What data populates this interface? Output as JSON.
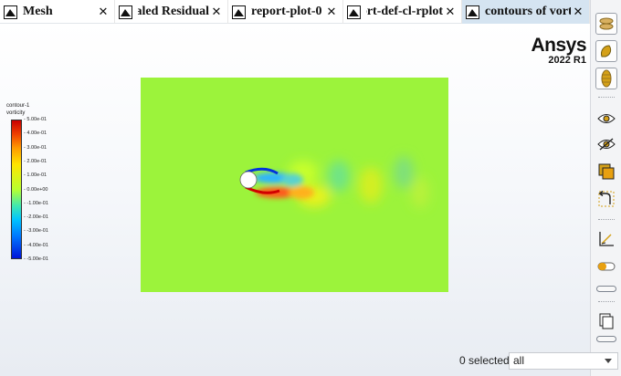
{
  "tabs": [
    {
      "label": "Mesh",
      "active": false
    },
    {
      "label": "Scaled Residual",
      "active": false
    },
    {
      "label": "report-plot-0",
      "active": false
    },
    {
      "label": "report-def-cl-rplot",
      "active": false
    },
    {
      "label": "contours of vorticity",
      "active": true
    }
  ],
  "brand": {
    "logo": "Ansys",
    "version": "2022 R1"
  },
  "legend": {
    "title_line1": "contour-1",
    "title_line2": "vorticity",
    "ticks": [
      "5.00e-01",
      "4.00e-01",
      "3.00e-01",
      "2.00e-01",
      "1.00e-01",
      "0.00e+00",
      "-1.00e-01",
      "-2.00e-01",
      "-3.00e-01",
      "-4.00e-01",
      "-5.00e-01"
    ]
  },
  "selection": {
    "count_text": "0 selected",
    "filter_value": "all"
  },
  "colors": {
    "field": "#9cf33b",
    "active_tab": "#d5e4f1",
    "accent_icon": "#d4a017"
  },
  "toolbar_icons": [
    "display-icon",
    "color-icon",
    "contour-icon",
    "show-icon",
    "hide-icon",
    "copy-icon",
    "undo-icon",
    "axes-icon",
    "slider-icon",
    "panel-icon"
  ]
}
